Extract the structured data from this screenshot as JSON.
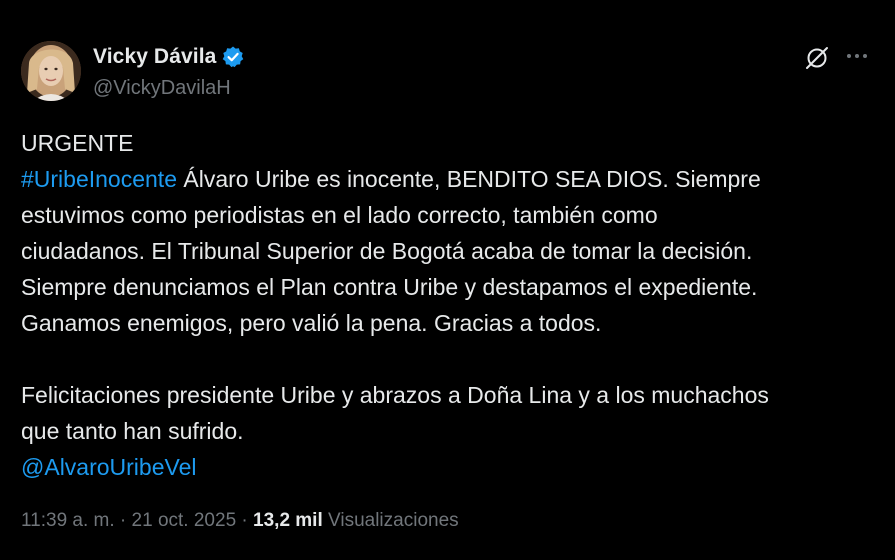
{
  "author": {
    "display_name": "Vicky Dávila",
    "handle": "@VickyDavilaH",
    "verified": true
  },
  "actions": {
    "grok_icon": "grok-slash-circle-icon",
    "more_icon": "more-horizontal-icon"
  },
  "tweet": {
    "line1": "URGENTE",
    "line2_hashtag": "#UribeInocente",
    "line2_rest": " Álvaro Uribe es inocente, BENDITO SEA DIOS. Siempre",
    "line3": "estuvimos como periodistas en el lado correcto, también como",
    "line4": "ciudadanos. El Tribunal Superior de Bogotá acaba de tomar la decisión.",
    "line5": "Siempre denunciamos el Plan contra Uribe y destapamos el expediente.",
    "line6": "Ganamos enemigos, pero valió la pena. Gracias a todos.",
    "line7": "Felicitaciones presidente Uribe y abrazos a Doña Lina y a los muchachos",
    "line8": "que tanto han sufrido.",
    "mention": "@AlvaroUribeVel"
  },
  "meta": {
    "time": "11:39 a. m.",
    "separator": " · ",
    "date": "21 oct. 2025",
    "views_count": "13,2 mil",
    "views_label": "Visualizaciones"
  },
  "colors": {
    "background": "#000000",
    "text": "#e7e9ea",
    "secondary": "#71767b",
    "link": "#1d9bf0"
  }
}
